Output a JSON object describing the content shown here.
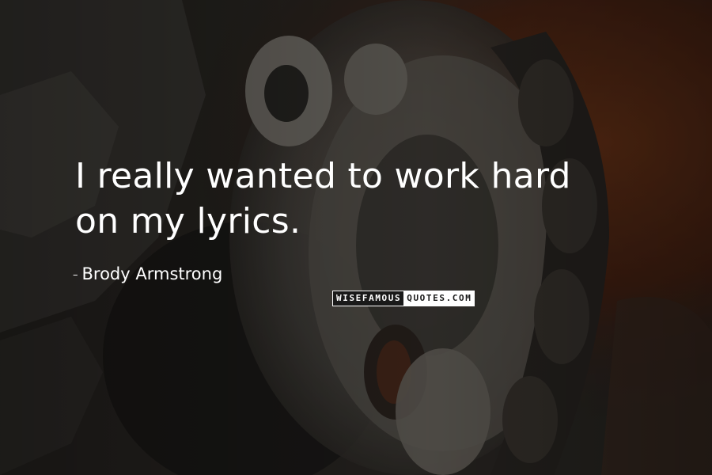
{
  "quote": {
    "line1": "I really wanted to work hard",
    "line2": "on my lyrics."
  },
  "attribution": {
    "dash": "–",
    "author": "Brody Armstrong"
  },
  "watermark": {
    "part1": "WISEFAMOUS",
    "part2": "QUOTES.COM"
  },
  "colors": {
    "text": "#ffffff",
    "background_dark": "#2a2723",
    "background_warm": "#5a2a14"
  }
}
